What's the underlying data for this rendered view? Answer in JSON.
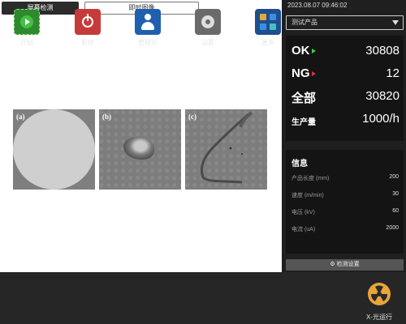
{
  "tabs": {
    "active": "屏幕检测",
    "inactive": "即时图像"
  },
  "panels": [
    {
      "label": "(a)"
    },
    {
      "label": "(b)"
    },
    {
      "label": "(c)"
    }
  ],
  "sidebar": {
    "datetime": "2023.08.07  09:46:02",
    "product_select": "测试产品",
    "stats": {
      "ok_label": "OK",
      "ok_value": "30808",
      "ng_label": "NG",
      "ng_value": "12",
      "all_label": "全部",
      "all_value": "30820",
      "rate_label": "生产量",
      "rate_value": "1000/h"
    },
    "info": {
      "title": "信息",
      "rows": [
        {
          "label": "产品长度 (mm)",
          "value": "200"
        },
        {
          "label": "速度 (m/min)",
          "value": "30"
        },
        {
          "label": "电压 (kV)",
          "value": "60"
        },
        {
          "label": "电流 (uA)",
          "value": "2000"
        }
      ]
    },
    "detect_settings": "检测设置"
  },
  "toolbar": {
    "start": "开始",
    "pause": "暂停",
    "admin": "管理员",
    "settings": "设置",
    "more": "更多",
    "xray": "X-光运行"
  },
  "colors": {
    "ok_arrow": "#3bd23b",
    "ng_arrow": "#e03030",
    "start": "#2f8a2f",
    "pause": "#c63a3a",
    "admin": "#1f5fb0",
    "xray": "#e8a53a"
  }
}
